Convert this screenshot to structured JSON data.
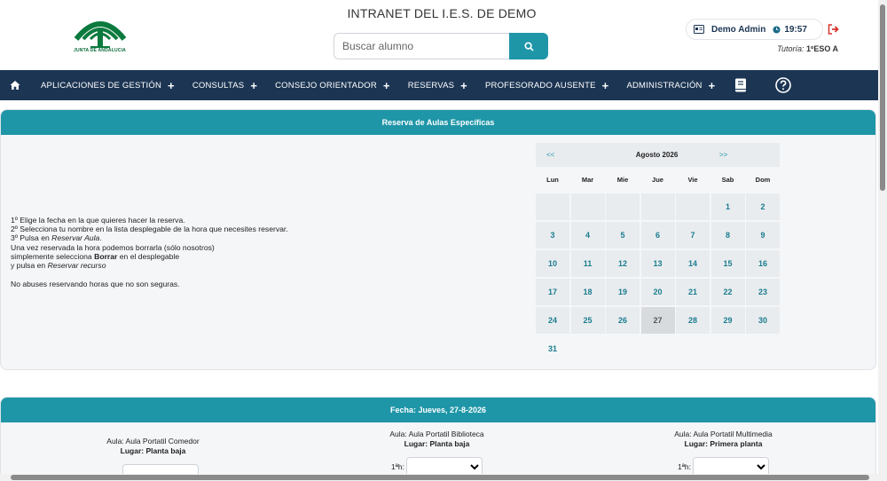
{
  "header": {
    "logo_text": "JUNTA DE ANDALUCIA",
    "site_title": "INTRANET DEL I.E.S. DE DEMO",
    "search_placeholder": "Buscar alumno",
    "user_name": "Demo Admin",
    "time": "19:57",
    "tutoria_label": "Tutoría:",
    "tutoria_value": "1ºESO A",
    "icons": [
      "id-card-icon",
      "clock-icon",
      "logout-icon",
      "search-icon"
    ]
  },
  "nav": {
    "items": [
      {
        "label": "APLICACIONES DE GESTIÓN"
      },
      {
        "label": "CONSULTAS"
      },
      {
        "label": "CONSEJO ORIENTADOR"
      },
      {
        "label": "RESERVAS"
      },
      {
        "label": "PROFESORADO AUSENTE"
      },
      {
        "label": "ADMINISTRACIÓN"
      }
    ],
    "plus": "+",
    "icons": [
      "home-icon",
      "book-icon",
      "help-icon"
    ]
  },
  "reserva": {
    "title": "Reserva de Aulas Específicas",
    "line1": "1º Elige la fecha en la que quieres hacer la reserva.",
    "line2": "2º Selecciona tu nombre en la lista desplegable de la hora que necesites reservar.",
    "line3_pre": "3º Pulsa en ",
    "line3_em": "Reservar Aula",
    "line3_post": ".",
    "line4": "Una vez reservada la hora podemos borrarla (sólo nosotros)",
    "line5_pre": "simplemente selecciona ",
    "line5_b": "Borrar",
    "line5_post": " en el desplegable",
    "line6_pre": "y pulsa en ",
    "line6_em": "Reservar recurso",
    "line7": "No abuses reservando horas que no son seguras."
  },
  "calendar": {
    "prev": "<<",
    "month": "Agosto 2026",
    "next": ">>",
    "weekdays": [
      "Lun",
      "Mar",
      "Mie",
      "Jue",
      "Vie",
      "Sab",
      "Dom"
    ],
    "leading_blanks": 5,
    "days": [
      "1",
      "2",
      "3",
      "4",
      "5",
      "6",
      "7",
      "8",
      "9",
      "10",
      "11",
      "12",
      "13",
      "14",
      "15",
      "16",
      "17",
      "18",
      "19",
      "20",
      "21",
      "22",
      "23",
      "24",
      "25",
      "26",
      "27",
      "28",
      "29",
      "30",
      "31"
    ],
    "selected_day": "27"
  },
  "fecha": {
    "title": "Fecha: Jueves, 27-8-2026",
    "aulas": [
      {
        "name": "Aula: Aula Portatil Comedor",
        "lugar_label": "Lugar:",
        "lugar": "Planta baja"
      },
      {
        "name": "Aula: Aula Portatil Biblioteca",
        "lugar_label": "Lugar:",
        "lugar": "Planta baja",
        "hora_label": "1ªh:"
      },
      {
        "name": "Aula: Aula Portatil Multimedia",
        "lugar_label": "Lugar:",
        "lugar": "Primera planta",
        "hora_label": "1ªh:"
      }
    ]
  }
}
